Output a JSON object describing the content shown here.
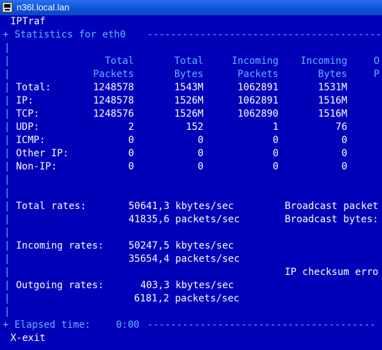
{
  "window": {
    "title": "n36l.local.lan"
  },
  "terminal": {
    "app_name": "IPTraf",
    "header_label": "+ Statistics for eth0 ",
    "header_dashes": "-----------------------------------------------------",
    "border_char": "|",
    "columns": [
      {
        "line1": "Total",
        "line2": "Packets"
      },
      {
        "line1": "Total",
        "line2": "Bytes"
      },
      {
        "line1": "Incoming",
        "line2": "Packets"
      },
      {
        "line1": "Incoming",
        "line2": "Bytes"
      },
      {
        "line1": "O",
        "line2": "P"
      }
    ],
    "rows": [
      {
        "label": "Total:",
        "values": [
          "1248578",
          "1543M",
          "1062891",
          "1531M"
        ]
      },
      {
        "label": "IP:",
        "values": [
          "1248578",
          "1526M",
          "1062891",
          "1516M"
        ]
      },
      {
        "label": "TCP:",
        "values": [
          "1248576",
          "1526M",
          "1062890",
          "1516M"
        ]
      },
      {
        "label": "UDP:",
        "values": [
          "2",
          "152",
          "1",
          "76"
        ]
      },
      {
        "label": "ICMP:",
        "values": [
          "0",
          "0",
          "0",
          "0"
        ]
      },
      {
        "label": "Other IP:",
        "values": [
          "0",
          "0",
          "0",
          "0"
        ]
      },
      {
        "label": "Non-IP:",
        "values": [
          "0",
          "0",
          "0",
          "0"
        ]
      }
    ],
    "rates": {
      "total_label": "Total rates:",
      "total_kbytes": "50641,3 kbytes/sec",
      "total_packets": "41835,6 packets/sec",
      "incoming_label": "Incoming rates:",
      "incoming_kbytes": "50247,5 kbytes/sec",
      "incoming_packets": "35654,4 packets/sec",
      "outgoing_label": "Outgoing rates:",
      "outgoing_kbytes": "403,3 kbytes/sec",
      "outgoing_packets": "6181,2 packets/sec"
    },
    "right_info": {
      "broadcast_packets": "Broadcast packet",
      "broadcast_bytes": "Broadcast bytes:",
      "ip_checksum": "IP checksum erro"
    },
    "footer": {
      "elapsed_label": "+ Elapsed time:",
      "elapsed_value": "0:00",
      "elapsed_dashes": "---------------------------------------",
      "exit_hint": "X-exit"
    }
  },
  "colors": {
    "background": "#0000b8",
    "text": "#ffffff",
    "accent": "#5eb4ff"
  }
}
